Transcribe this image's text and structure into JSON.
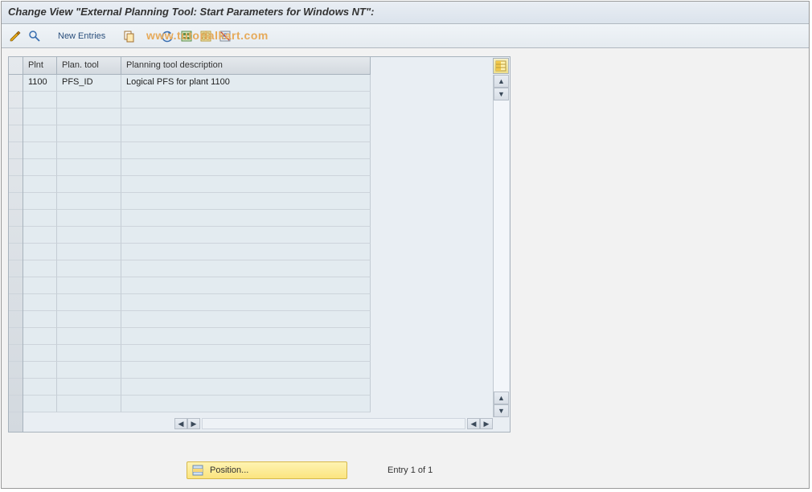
{
  "title": "Change View \"External Planning Tool: Start Parameters for Windows NT\":",
  "watermark": "www.tutorialkart.com",
  "toolbar": {
    "new_entries_label": "New Entries"
  },
  "grid": {
    "columns": {
      "plnt": "Plnt",
      "plan_tool": "Plan. tool",
      "desc": "Planning tool description"
    },
    "rows": [
      {
        "plnt": "1100",
        "plan_tool": "PFS_ID",
        "desc": "Logical PFS for plant 1100"
      }
    ],
    "empty_rows": 19
  },
  "footer": {
    "position_label": "Position...",
    "entry_text": "Entry 1 of 1"
  }
}
